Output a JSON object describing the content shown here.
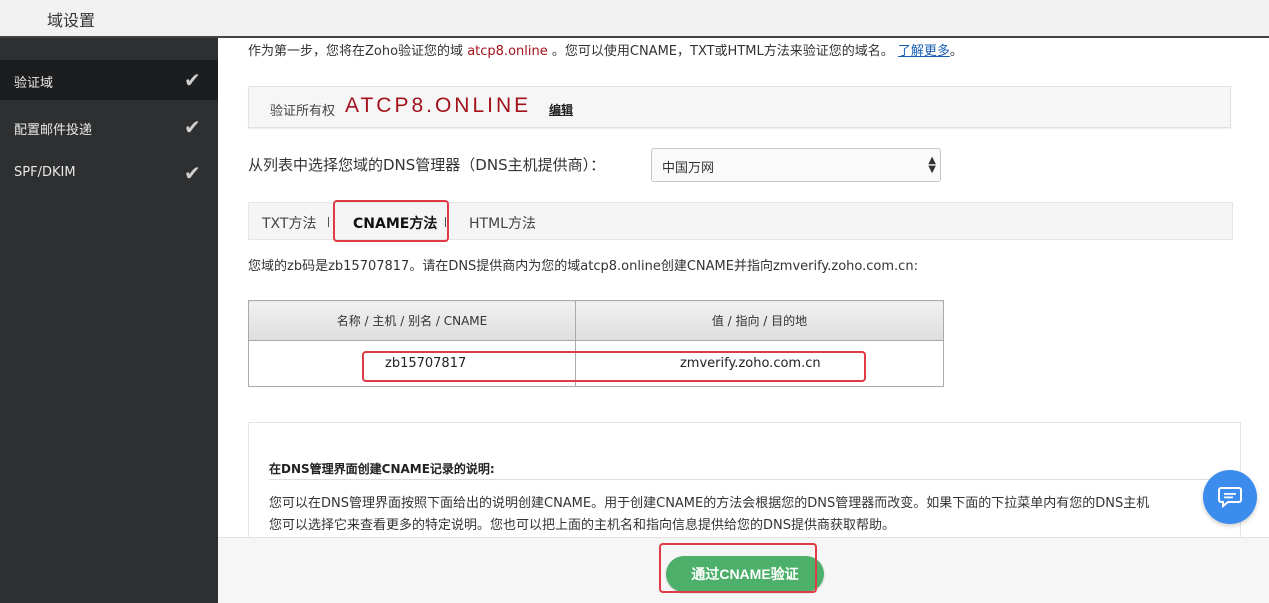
{
  "header": {
    "title": "域设置"
  },
  "sidebar": {
    "items": [
      {
        "label": "验证域",
        "check": "✔",
        "active": true
      },
      {
        "label": "配置邮件投递",
        "check": "✔",
        "active": false
      },
      {
        "label": "SPF/DKIM",
        "check": "✔",
        "active": false
      }
    ]
  },
  "intro": {
    "before": "作为第一步，您将在Zoho验证您的域",
    "domain": "atcp8.online",
    "after": "。您可以使用CNAME，TXT或HTML方法来验证您的域名。",
    "link": "了解更多",
    "tail": "。"
  },
  "ownership": {
    "label": "验证所有权",
    "domain": "ATCP8.ONLINE",
    "edit": "编辑"
  },
  "dns": {
    "label": "从列表中选择您域的DNS管理器（DNS主机提供商）：",
    "selected": "中国万网"
  },
  "tabs": [
    {
      "label": "TXT方法",
      "active": false
    },
    {
      "label": "CNAME方法",
      "active": true
    },
    {
      "label": "HTML方法",
      "active": false
    }
  ],
  "zb_instruction": "您域的zb码是zb15707817。请在DNS提供商内为您的域atcp8.online创建CNAME并指向zmverify.zoho.com.cn:",
  "cname_table": {
    "headers": [
      "名称 / 主机 / 别名 / CNAME",
      "值 / 指向 / 目的地"
    ],
    "rows": [
      [
        "zb15707817",
        "zmverify.zoho.com.cn"
      ]
    ]
  },
  "instructions": {
    "heading": "在DNS管理界面创建CNAME记录的说明:",
    "line1": "您可以在DNS管理界面按照下面给出的说明创建CNAME。用于创建CNAME的方法会根据您的DNS管理器而改变。如果下面的下拉菜单内有您的DNS主机",
    "line2": "您可以选择它来查看更多的特定说明。您也可以把上面的主机名和指向信息提供给您的DNS提供商获取帮助。"
  },
  "verify_button": "通过CNAME验证",
  "colors": {
    "accent_red": "#a3121b",
    "highlight": "#e03a47",
    "button_green": "#4caf6a",
    "sidebar": "#2d2f31",
    "chat": "#3b8ced"
  },
  "icons": {
    "check": "check-icon",
    "chat": "chat-icon",
    "select": "select-arrows-icon"
  }
}
